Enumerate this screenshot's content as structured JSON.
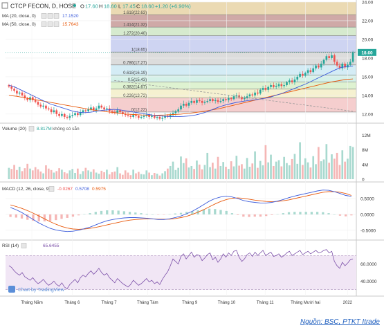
{
  "header": {
    "symbol_line": "CTCP FECON, D, HOSE",
    "open_label": "O",
    "open": "17.60",
    "high_label": "H",
    "high": "18.60",
    "low_label": "L",
    "low": "17.45",
    "close_label": "C",
    "close": "18.60",
    "change": "+1.20 (+6.90%)"
  },
  "indicators": {
    "ma20_label": "MA (20, close, 0)",
    "ma20_value": "17.1520",
    "ma50_label": "MA (50, close, 0)",
    "ma50_value": "15.7643",
    "volume_label": "Volume (20)",
    "volume_value": "8.817M",
    "volume_note": "không có sẵn",
    "macd_label": "MACD (12, 26, close, 9)",
    "macd_hist": "-0.0267",
    "macd_line": "0.5708",
    "macd_signal": "0.5975",
    "rsi_label": "RSI (14)",
    "rsi_value": "65.6455"
  },
  "watermark": "Chart by TradingView",
  "price_badge": "18.60",
  "source": "Nguồn: BSC, PTKT Itrade",
  "colors": {
    "up": "#26a69a",
    "down": "#ef5350",
    "ma20": "#3b5bdb",
    "ma50": "#e8590c",
    "macd": "#3b5bdb",
    "signal": "#e8590c",
    "rsi": "#7b4fa8",
    "rsi_band": "#f1e6f5"
  },
  "chart_data": [
    {
      "type": "candlestick",
      "x_ticks": [
        "Tháng Năm",
        "Tháng 6",
        "Tháng 7",
        "Tháng Tám",
        "Tháng 9",
        "Tháng 10",
        "Tháng 11",
        "Tháng Mười hai",
        "2022"
      ],
      "y_ticks": [
        "24.00",
        "22.00",
        "20.00",
        "18.00",
        "16.00",
        "14.00",
        "12.00"
      ],
      "ylim": [
        11.1,
        24.0
      ],
      "fibonacci_levels": [
        {
          "label": "1.618",
          "value": 22.63,
          "fill": "#e7d3a6"
        },
        {
          "label": "1.414",
          "value": 21.32,
          "fill": "#c79a98"
        },
        {
          "label": "1.272",
          "value": 20.4,
          "fill": "#cfe6c6"
        },
        {
          "label": "1",
          "value": 18.65,
          "fill": "#c6cdf0"
        },
        {
          "label": "0.786",
          "value": 17.27,
          "fill": "#d6d6d6"
        },
        {
          "label": "0.618",
          "value": 16.19,
          "fill": "#cde9f3"
        },
        {
          "label": "0.5",
          "value": 15.43,
          "fill": "#cdeee5"
        },
        {
          "label": "0.382",
          "value": 14.67,
          "fill": "#d8f0c9"
        },
        {
          "label": "0.236",
          "value": 13.73,
          "fill": "#f3efc8"
        },
        {
          "label": "0",
          "value": 12.22,
          "fill": "#f3c6c6"
        }
      ],
      "fib_label_format": "{label}({value})",
      "close_series": [
        14.95,
        14.7,
        14.5,
        14.2,
        14.3,
        14.0,
        13.7,
        13.5,
        13.8,
        13.5,
        13.3,
        13.0,
        12.8,
        12.9,
        12.6,
        12.5,
        12.2,
        12.4,
        12.0,
        11.8,
        12.0,
        11.7,
        11.6,
        11.8,
        11.9,
        12.1,
        11.9,
        12.2,
        12.4,
        12.3,
        12.5,
        12.7,
        12.4,
        12.6,
        12.9,
        12.7,
        12.5,
        12.6,
        12.3,
        12.2,
        12.1,
        12.4,
        12.2,
        12.0,
        11.9,
        11.8,
        11.7,
        11.9,
        11.8,
        11.6,
        11.7,
        11.8,
        11.9,
        11.7,
        11.8,
        11.6,
        11.7,
        11.5,
        11.6,
        11.8,
        11.7,
        11.9,
        12.1,
        12.3,
        12.5,
        12.9,
        13.1,
        12.9,
        13.2,
        13.4,
        13.2,
        13.5,
        13.4,
        13.2,
        13.3,
        13.4,
        13.6,
        13.4,
        13.5,
        13.3,
        13.4,
        13.6,
        13.5,
        13.7,
        13.6,
        13.9,
        14.0,
        13.8,
        13.6,
        13.7,
        13.9,
        14.1,
        14.0,
        14.3,
        14.2,
        14.6,
        14.8,
        14.6,
        14.9,
        15.1,
        14.9,
        15.0,
        15.2,
        15.0,
        15.1,
        15.4,
        15.6,
        15.4,
        15.7,
        16.0,
        16.3,
        16.1,
        16.4,
        16.7,
        16.5,
        16.9,
        17.2,
        17.0,
        17.4,
        17.8,
        18.2,
        18.0,
        18.3,
        17.6,
        17.2,
        16.9,
        17.4,
        17.0,
        17.3,
        17.6,
        18.6
      ],
      "ma20": [
        15.1,
        14.9,
        14.6,
        14.3,
        14.0,
        13.7,
        13.4,
        13.1,
        12.9,
        12.7,
        12.5,
        12.3,
        12.2,
        12.15,
        12.2,
        12.3,
        12.4,
        12.45,
        12.5,
        12.45,
        12.35,
        12.25,
        12.15,
        12.05,
        11.95,
        11.85,
        11.8,
        11.75,
        11.72,
        11.72,
        11.75,
        11.8,
        11.9,
        12.05,
        12.25,
        12.5,
        12.75,
        12.95,
        13.1,
        13.25,
        13.35,
        13.45,
        13.5,
        13.6,
        13.7,
        13.85,
        14.05,
        14.25,
        14.5,
        14.75,
        15.0,
        15.25,
        15.55,
        15.85,
        16.15,
        16.45,
        16.75,
        17.0,
        17.1,
        17.15
      ],
      "ma50": [
        14.0,
        13.9,
        13.75,
        13.6,
        13.45,
        13.3,
        13.15,
        13.0,
        12.85,
        12.7,
        12.55,
        12.4,
        12.3,
        12.2,
        12.1,
        12.0,
        11.95,
        11.9,
        11.88,
        11.88,
        11.9,
        11.95,
        12.0,
        12.08,
        12.18,
        12.3,
        12.45,
        12.6,
        12.8,
        13.0,
        13.2,
        13.4,
        13.6,
        13.8,
        14.0,
        14.2,
        14.4,
        14.6,
        14.8,
        15.0,
        15.2,
        15.4,
        15.55,
        15.7,
        15.76
      ],
      "trendline": {
        "from": [
          0.31,
          15.6
        ],
        "to": [
          0.99,
          12.3
        ]
      }
    },
    {
      "type": "bar",
      "name": "Volume",
      "y_ticks": [
        "12M",
        "8M",
        "4M",
        "0"
      ],
      "ylim": [
        0,
        14
      ],
      "values": [
        3.1,
        2.8,
        3.9,
        2.5,
        3.4,
        2.2,
        3.0,
        4.2,
        2.9,
        2.4,
        3.3,
        2.7,
        2.1,
        1.6,
        3.8,
        2.9,
        2.5,
        1.8,
        2.2,
        3.0,
        2.6,
        1.9,
        1.6,
        2.4,
        2.8,
        1.7,
        2.9,
        1.4,
        2.2,
        3.1,
        2.4,
        2.0,
        2.7,
        1.8,
        1.5,
        2.3,
        1.9,
        2.6,
        1.3,
        1.9,
        2.1,
        3.3,
        1.6,
        1.2,
        2.4,
        1.8,
        1.1,
        2.6,
        1.6,
        2.0,
        1.4,
        1.3,
        2.4,
        1.8,
        1.1,
        1.7,
        1.5,
        1.0,
        1.6,
        2.2,
        2.9,
        3.6,
        4.8,
        2.5,
        3.1,
        6.2,
        4.4,
        5.7,
        3.2,
        3.6,
        2.8,
        5.1,
        4.0,
        2.7,
        3.9,
        7.2,
        3.3,
        4.5,
        2.9,
        6.1,
        3.6,
        4.7,
        3.4,
        2.8,
        4.9,
        3.5,
        6.4,
        3.7,
        4.1,
        2.9,
        5.8,
        3.4,
        4.3,
        7.6,
        3.1,
        5.0,
        3.8,
        9.3,
        4.6,
        6.7,
        3.6,
        4.8,
        5.2,
        3.5,
        6.1,
        4.4,
        3.8,
        5.5,
        6.9,
        4.2,
        10.1,
        3.9,
        5.7,
        4.6,
        3.2,
        6.3,
        4.1,
        8.8,
        4.9,
        5.4,
        9.6,
        4.5,
        6.8,
        5.6,
        7.2,
        3.9,
        7.9,
        4.8,
        5.6,
        9.1,
        8.8
      ]
    },
    {
      "type": "line",
      "name": "MACD",
      "y_ticks": [
        "0.5000",
        "0.0000",
        "-0.5000"
      ],
      "ylim": [
        -0.7,
        0.85
      ],
      "macd": [
        0.22,
        0.15,
        0.06,
        -0.05,
        -0.16,
        -0.27,
        -0.36,
        -0.44,
        -0.49,
        -0.52,
        -0.54,
        -0.53,
        -0.5,
        -0.45,
        -0.4,
        -0.33,
        -0.26,
        -0.2,
        -0.16,
        -0.13,
        -0.11,
        -0.1,
        -0.1,
        -0.11,
        -0.12,
        -0.14,
        -0.16,
        -0.16,
        -0.14,
        -0.1,
        -0.05,
        0.02,
        0.1,
        0.2,
        0.31,
        0.42,
        0.5,
        0.55,
        0.58,
        0.55,
        0.5,
        0.44,
        0.4,
        0.38,
        0.36,
        0.36,
        0.38,
        0.42,
        0.47,
        0.53,
        0.58,
        0.62,
        0.66,
        0.7,
        0.74,
        0.77,
        0.76,
        0.72,
        0.66,
        0.6,
        0.57
      ],
      "signal": [
        0.3,
        0.25,
        0.19,
        0.12,
        0.04,
        -0.05,
        -0.14,
        -0.23,
        -0.31,
        -0.38,
        -0.43,
        -0.46,
        -0.47,
        -0.46,
        -0.44,
        -0.41,
        -0.37,
        -0.33,
        -0.29,
        -0.25,
        -0.21,
        -0.18,
        -0.16,
        -0.15,
        -0.14,
        -0.14,
        -0.15,
        -0.15,
        -0.15,
        -0.13,
        -0.1,
        -0.06,
        0.0,
        0.07,
        0.15,
        0.24,
        0.33,
        0.41,
        0.47,
        0.51,
        0.52,
        0.51,
        0.48,
        0.45,
        0.43,
        0.41,
        0.4,
        0.41,
        0.43,
        0.46,
        0.5,
        0.54,
        0.58,
        0.62,
        0.66,
        0.7,
        0.72,
        0.72,
        0.7,
        0.66,
        0.6
      ]
    },
    {
      "type": "line",
      "name": "RSI",
      "y_ticks": [
        "60.0000",
        "40.0000"
      ],
      "ylim": [
        24,
        80
      ],
      "band": [
        30,
        70
      ],
      "values": [
        58,
        56,
        52,
        49,
        47,
        50,
        45,
        43,
        41,
        44,
        40,
        37,
        39,
        42,
        38,
        35,
        37,
        40,
        36,
        34,
        38,
        33,
        31,
        36,
        39,
        42,
        38,
        44,
        47,
        45,
        49,
        52,
        48,
        51,
        55,
        50,
        47,
        49,
        44,
        41,
        38,
        43,
        40,
        37,
        35,
        33,
        36,
        41,
        38,
        35,
        37,
        40,
        43,
        39,
        41,
        37,
        39,
        36,
        42,
        47,
        51,
        58,
        66,
        63,
        60,
        69,
        72,
        66,
        70,
        74,
        68,
        71,
        70,
        64,
        67,
        71,
        73,
        65,
        68,
        62,
        66,
        72,
        68,
        73,
        70,
        75,
        76,
        68,
        63,
        66,
        71,
        73,
        69,
        74,
        70,
        73,
        76,
        70,
        72,
        74,
        69,
        70,
        72,
        68,
        70,
        73,
        75,
        70,
        72,
        74,
        76,
        71,
        73,
        75,
        72,
        74,
        76,
        73,
        74,
        76,
        77,
        73,
        75,
        63,
        58,
        55,
        62,
        58,
        61,
        65,
        66
      ]
    }
  ]
}
